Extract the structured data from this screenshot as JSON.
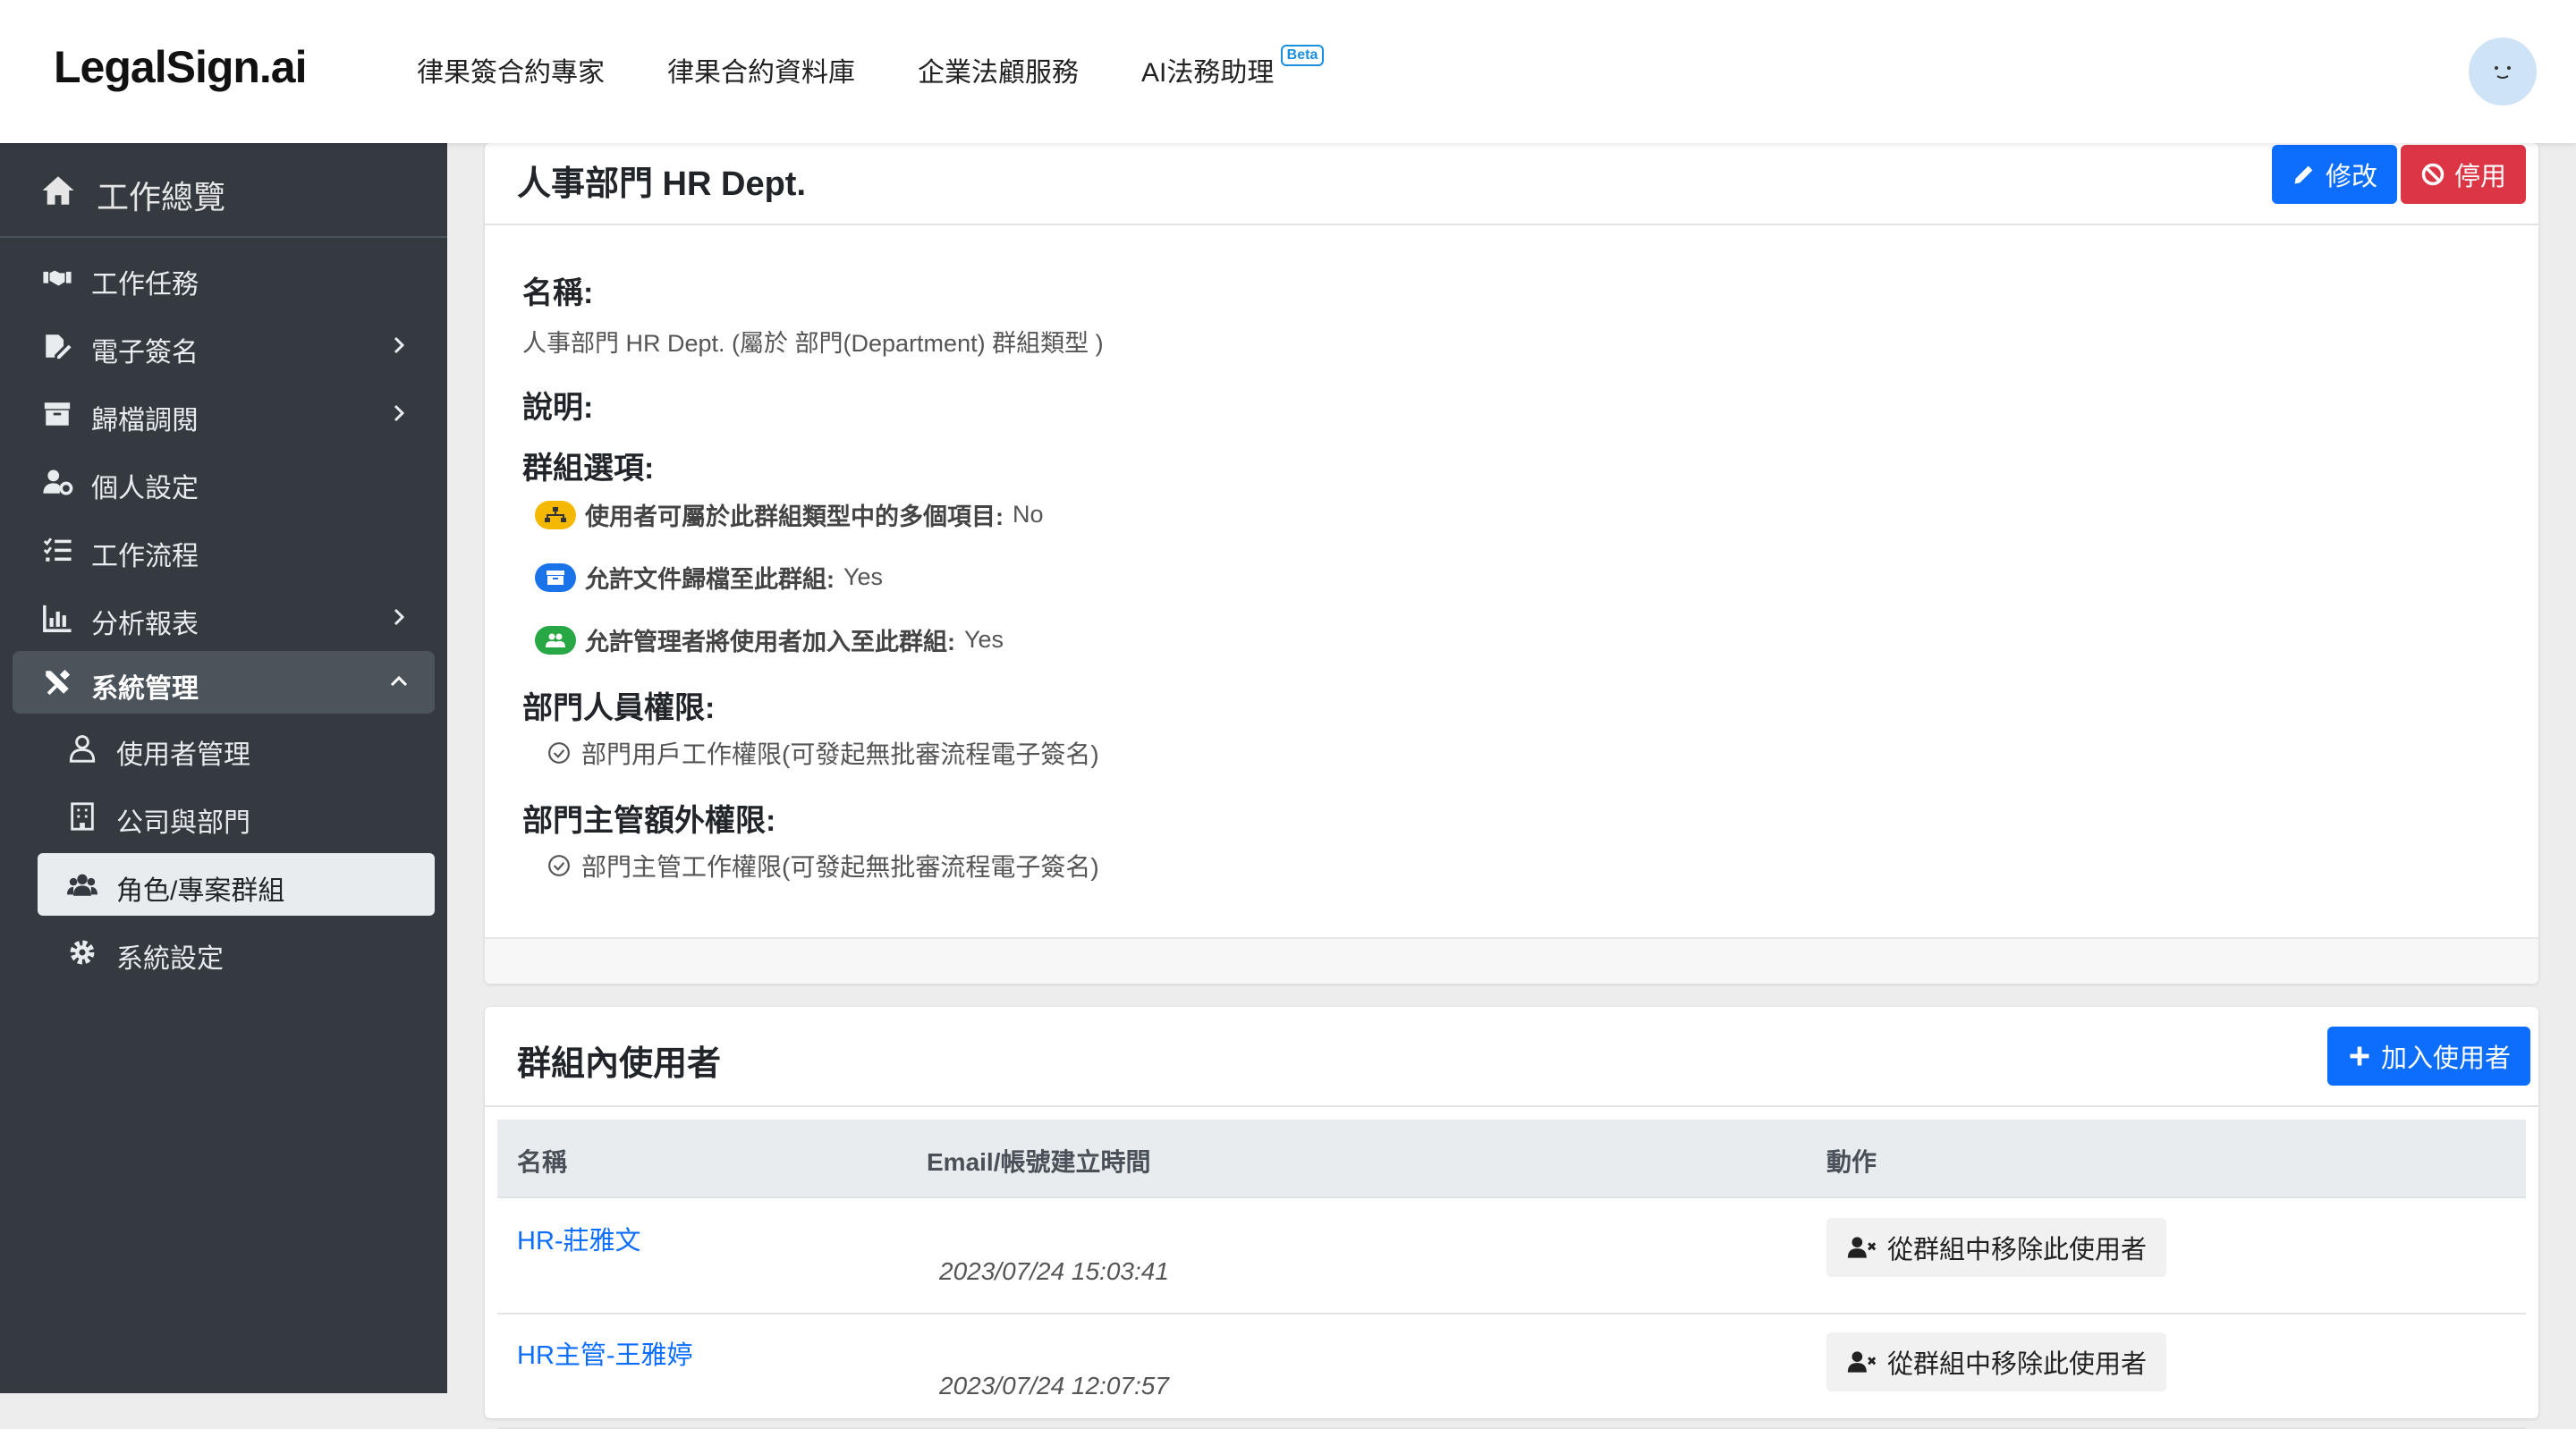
{
  "navbar": {
    "brand": "LegalSign.ai",
    "links": [
      "律果簽合約專家",
      "律果合約資料庫",
      "企業法顧服務",
      "AI法務助理"
    ],
    "beta_badge": "Beta"
  },
  "sidebar": {
    "home": "工作總覽",
    "items": [
      {
        "label": "工作任務",
        "icon": "handshake-icon"
      },
      {
        "label": "電子簽名",
        "icon": "signature-icon"
      },
      {
        "label": "歸檔調閱",
        "icon": "archive-icon"
      },
      {
        "label": "個人設定",
        "icon": "user-cog-icon"
      },
      {
        "label": "工作流程",
        "icon": "list-check-icon"
      },
      {
        "label": "分析報表",
        "icon": "chart-icon"
      },
      {
        "label": "系統管理",
        "icon": "tools-icon"
      }
    ],
    "sub_items": [
      {
        "label": "使用者管理",
        "icon": "user-icon"
      },
      {
        "label": "公司與部門",
        "icon": "building-icon"
      },
      {
        "label": "角色/專案群組",
        "icon": "users-icon"
      },
      {
        "label": "系統設定",
        "icon": "gear-icon"
      }
    ]
  },
  "group_card": {
    "title": "人事部門 HR Dept.",
    "edit_label": "修改",
    "disable_label": "停用",
    "name_heading": "名稱:",
    "name_value": "人事部門 HR Dept. (屬於 部門(Department) 群組類型 )",
    "desc_heading": "說明:",
    "options_heading": "群組選項:",
    "options": [
      {
        "label": "使用者可屬於此群組類型中的多個項目:",
        "value": "No",
        "color": "#f5b800"
      },
      {
        "label": "允許文件歸檔至此群組:",
        "value": "Yes",
        "color": "#1a73e8"
      },
      {
        "label": "允許管理者將使用者加入至此群組:",
        "value": "Yes",
        "color": "#28a745"
      }
    ],
    "dept_perm_heading": "部門人員權限:",
    "dept_perm_value": "部門用戶工作權限(可發起無批審流程電子簽名)",
    "mgr_perm_heading": "部門主管額外權限:",
    "mgr_perm_value": "部門主管工作權限(可發起無批審流程電子簽名)"
  },
  "users_card": {
    "title": "群組內使用者",
    "add_label": "加入使用者",
    "columns": [
      "名稱",
      "Email/帳號建立時間",
      "動作"
    ],
    "rows": [
      {
        "name": "HR-莊雅文",
        "created": "2023/07/24 15:03:41",
        "action": "從群組中移除此使用者"
      },
      {
        "name": "HR主管-王雅婷",
        "created": "2023/07/24 12:07:57",
        "action": "從群組中移除此使用者"
      }
    ]
  },
  "colors": {
    "sidebar_bg": "#343a40",
    "primary": "#0d6efd",
    "danger": "#dc3545"
  }
}
